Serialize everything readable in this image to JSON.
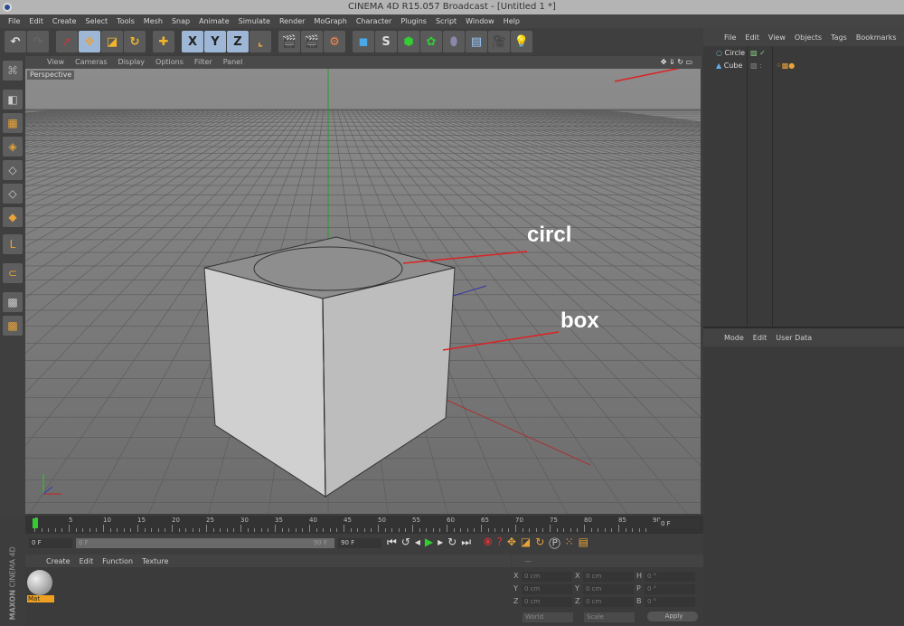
{
  "title": "CINEMA 4D R15.057 Broadcast - [Untitled 1 *]",
  "menu": [
    "File",
    "Edit",
    "Create",
    "Select",
    "Tools",
    "Mesh",
    "Snap",
    "Animate",
    "Simulate",
    "Render",
    "MoGraph",
    "Character",
    "Plugins",
    "Script",
    "Window",
    "Help"
  ],
  "toolbar": {
    "x": "X",
    "y": "Y",
    "z": "Z"
  },
  "viewport": {
    "menu": [
      "View",
      "Cameras",
      "Display",
      "Options",
      "Filter",
      "Panel"
    ],
    "label": "Perspective",
    "annotations": {
      "circle": "circl",
      "box": "box"
    }
  },
  "object_manager": {
    "menu": [
      "File",
      "Edit",
      "View",
      "Objects",
      "Tags",
      "Bookmarks"
    ],
    "objects": [
      {
        "name": "Circle"
      },
      {
        "name": "Cube"
      }
    ]
  },
  "attributes": {
    "menu": [
      "Mode",
      "Edit",
      "User Data"
    ]
  },
  "timeline": {
    "ticks": [
      "0",
      "5",
      "10",
      "15",
      "20",
      "25",
      "30",
      "35",
      "40",
      "45",
      "50",
      "55",
      "60",
      "65",
      "70",
      "75",
      "80",
      "85",
      "90"
    ],
    "current": "0 F"
  },
  "controls": {
    "start": "0 F",
    "range_start": "0 F",
    "range_end": "90 F",
    "end": "90 F"
  },
  "materials": {
    "menu": [
      "Create",
      "Edit",
      "Function",
      "Texture"
    ],
    "items": [
      {
        "name": "Mat"
      }
    ]
  },
  "coordinates": {
    "rows": [
      {
        "a": "X",
        "av": "0 cm",
        "b": "X",
        "bv": "0 cm",
        "c": "H",
        "cv": "0 °"
      },
      {
        "a": "Y",
        "av": "0 cm",
        "b": "Y",
        "bv": "0 cm",
        "c": "P",
        "cv": "0 °"
      },
      {
        "a": "Z",
        "av": "0 cm",
        "b": "Z",
        "bv": "0 cm",
        "c": "B",
        "cv": "0 °"
      }
    ],
    "space": "World",
    "mode": "Scale",
    "apply": "Apply"
  },
  "brand": {
    "maxon": "MAXON",
    "product": "CINEMA 4D"
  }
}
